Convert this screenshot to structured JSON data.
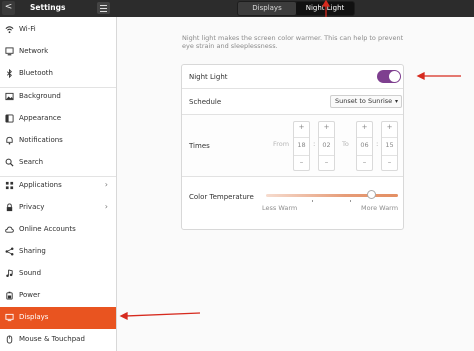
{
  "header": {
    "back_glyph": "<",
    "title": "Settings",
    "tabs": [
      {
        "label": "Displays"
      },
      {
        "label": "Night Light"
      }
    ]
  },
  "sidebar": {
    "items": [
      {
        "label": "Wi-Fi",
        "icon": "wifi-icon"
      },
      {
        "label": "Network",
        "icon": "network-icon"
      },
      {
        "label": "Bluetooth",
        "icon": "bluetooth-icon"
      },
      {
        "label": "Background",
        "icon": "background-icon"
      },
      {
        "label": "Appearance",
        "icon": "appearance-icon"
      },
      {
        "label": "Notifications",
        "icon": "notifications-icon"
      },
      {
        "label": "Search",
        "icon": "search-icon"
      },
      {
        "label": "Applications",
        "icon": "applications-icon"
      },
      {
        "label": "Privacy",
        "icon": "privacy-icon"
      },
      {
        "label": "Online Accounts",
        "icon": "online-accounts-icon"
      },
      {
        "label": "Sharing",
        "icon": "sharing-icon"
      },
      {
        "label": "Sound",
        "icon": "sound-icon"
      },
      {
        "label": "Power",
        "icon": "power-icon"
      },
      {
        "label": "Displays",
        "icon": "displays-icon"
      },
      {
        "label": "Mouse & Touchpad",
        "icon": "mouse-icon"
      }
    ]
  },
  "night_light": {
    "description": "Night light makes the screen color warmer. This can help to prevent eye strain and sleeplessness.",
    "toggle_label": "Night Light",
    "toggle_on": true,
    "schedule_label": "Schedule",
    "schedule_value": "Sunset to Sunrise",
    "times_label": "Times",
    "from_label": "From",
    "to_label": "To",
    "from_hour": "18",
    "from_minute": "02",
    "to_hour": "06",
    "to_minute": "15",
    "plus": "+",
    "minus": "–",
    "colon": ":",
    "color_temp_label": "Color Temperature",
    "less_warm": "Less Warm",
    "more_warm": "More Warm",
    "color_temp_level": 0.8
  },
  "colors": {
    "accent": "#e95420",
    "toggle": "#7e3f8f",
    "annotation": "#d62a1e"
  }
}
